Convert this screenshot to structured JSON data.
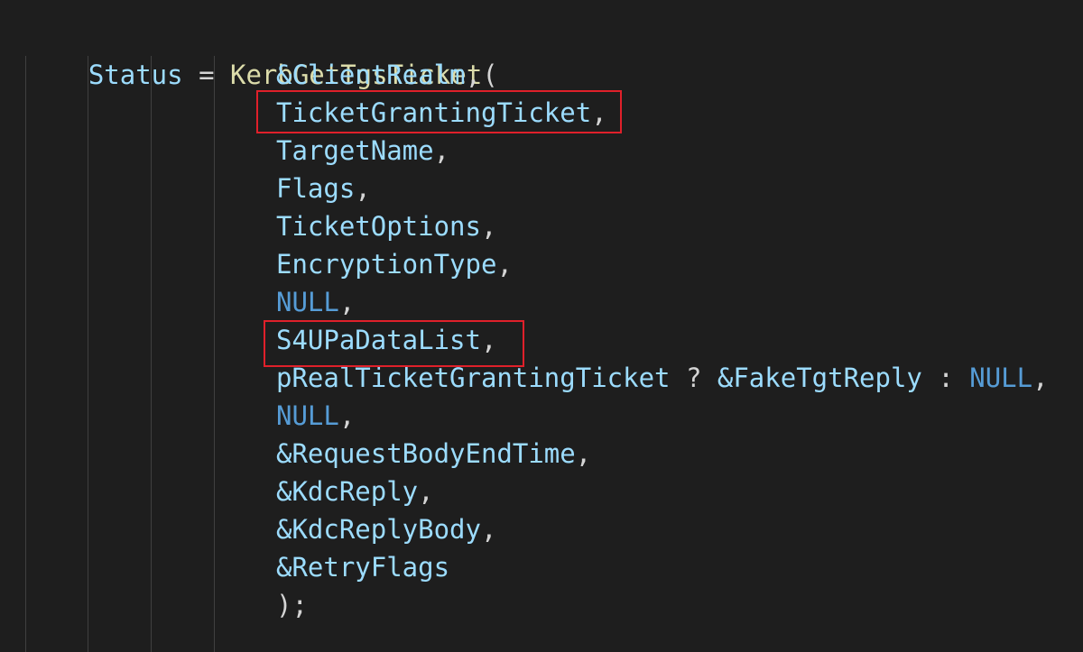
{
  "code": {
    "first_line": {
      "var": "Status",
      "op": " = ",
      "fn": "KerbGetTgsTicket",
      "paren": "("
    },
    "args": [
      {
        "text": "&ClientRealm",
        "suffix": ","
      },
      {
        "text": "TicketGrantingTicket",
        "suffix": ","
      },
      {
        "text": "TargetName",
        "suffix": ","
      },
      {
        "text": "Flags",
        "suffix": ","
      },
      {
        "text": "TicketOptions",
        "suffix": ","
      },
      {
        "text": "EncryptionType",
        "suffix": ","
      },
      {
        "text": "NULL",
        "suffix": ","
      },
      {
        "text": "S4UPaDataList",
        "suffix": ","
      },
      {
        "text": "pRealTicketGrantingTicket",
        "op1": " ? ",
        "text2": "&FakeTgtReply",
        "op2": " : ",
        "kw": "NULL",
        "suffix": ","
      },
      {
        "text": "NULL",
        "suffix": ","
      },
      {
        "text": "&RequestBodyEndTime",
        "suffix": ","
      },
      {
        "text": "&KdcReply",
        "suffix": ","
      },
      {
        "text": "&KdcReplyBody",
        "suffix": ","
      },
      {
        "text": "&RetryFlags",
        "suffix": ""
      }
    ],
    "closing": ");"
  },
  "colors": {
    "background": "#1e1e1e",
    "variable": "#9cdcfe",
    "function": "#dcdcaa",
    "keyword": "#569cd6",
    "operator": "#d4d4d4",
    "highlight_border": "#e0202a",
    "indent_guide": "#404040"
  }
}
